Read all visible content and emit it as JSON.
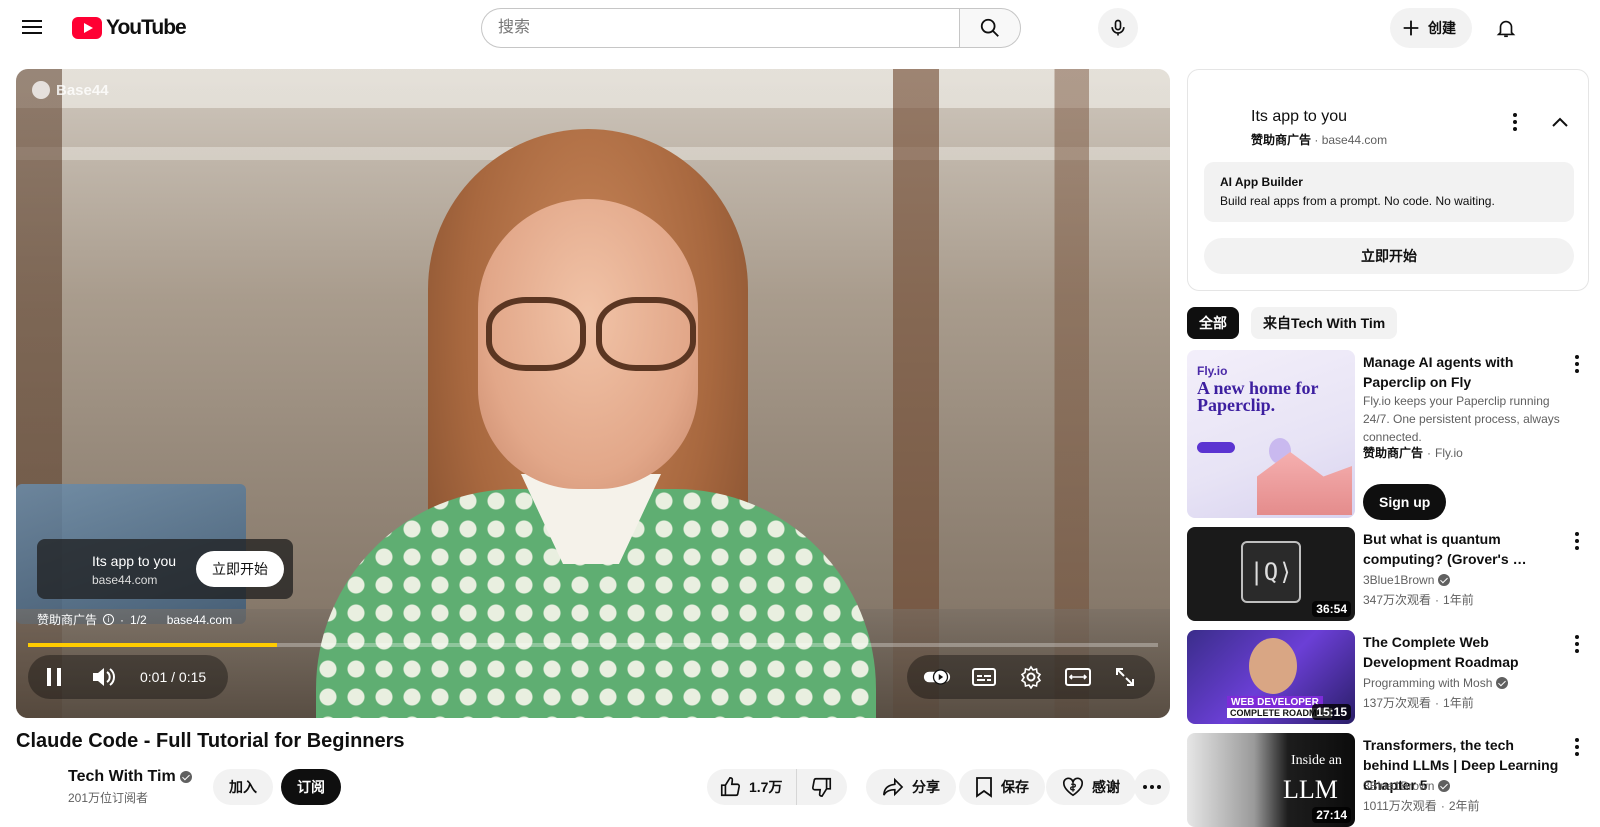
{
  "header": {
    "logo_text": "YouTube",
    "search_placeholder": "搜索",
    "create_label": "创建"
  },
  "player": {
    "watermark": "Base44",
    "ad_card": {
      "title": "Its app to you",
      "domain": "base44.com",
      "cta": "立即开始"
    },
    "ad_info": {
      "sponsored": "赞助商广告",
      "counter": "1/2",
      "domain": "base44.com"
    },
    "time_current": "0:01",
    "time_separator": "/",
    "time_total": "0:15",
    "progress_fraction": 0.22
  },
  "video": {
    "title": "Claude Code - Full Tutorial for Beginners",
    "channel_name": "Tech With Tim",
    "subscribers": "201万位订阅者",
    "join_label": "加入",
    "subscribe_label": "订阅",
    "like_count": "1.7万",
    "share_label": "分享",
    "save_label": "保存",
    "thanks_label": "感谢"
  },
  "ad_panel": {
    "title": "Its app to you",
    "sponsored": "赞助商广告",
    "domain": "base44.com",
    "headline": "AI App Builder",
    "description": "Build real apps from a prompt. No code. No waiting.",
    "cta": "立即开始"
  },
  "chips": [
    {
      "label": "全部",
      "active": true
    },
    {
      "label": "来自Tech With Tim",
      "active": false
    }
  ],
  "recommendations": {
    "ad": {
      "thumb_brand": "Fly.io",
      "thumb_headline": "A new home for Paperclip.",
      "title": "Manage AI agents with Paperclip on Fly",
      "description": "Fly.io keeps your Paperclip running 24/7. One persistent process, always connected.",
      "sponsored": "赞助商广告",
      "advertiser": "Fly.io",
      "cta": "Sign up"
    },
    "items": [
      {
        "title": "But what is quantum computing?  (Grover's …",
        "channel": "3Blue1Brown",
        "views": "347万次观看",
        "age": "1年前",
        "duration": "36:54",
        "thumb_text": "|Q⟩"
      },
      {
        "title": "The Complete Web Development Roadmap",
        "channel": "Programming with Mosh",
        "views": "137万次观看",
        "age": "1年前",
        "duration": "15:15",
        "thumb_label": "WEB DEVELOPER",
        "thumb_sub": "COMPLETE ROADMAP"
      },
      {
        "title": "Transformers, the tech behind LLMs | Deep Learning Chapter 5",
        "channel": "3Blue1Brown",
        "views": "1011万次观看",
        "age": "2年前",
        "duration": "27:14",
        "thumb_text_small": "Inside an",
        "thumb_text_big": "LLM"
      }
    ]
  },
  "colors": {
    "brand_red": "#ff0033",
    "progress_ad_yellow": "#ffcc00",
    "text_primary": "#0f0f0f",
    "text_secondary": "#606060"
  }
}
